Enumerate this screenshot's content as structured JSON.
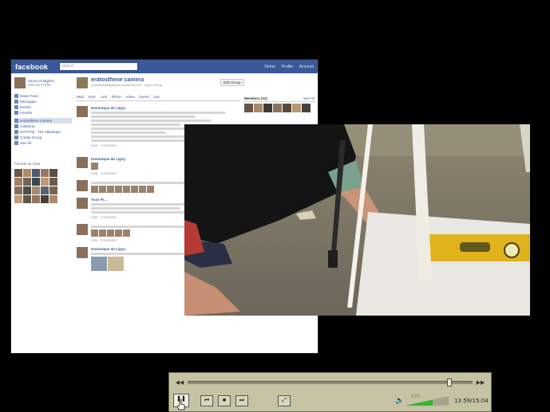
{
  "facebook": {
    "logo": "facebook",
    "search_placeholder": "search",
    "nav": [
      "Home",
      "Profile",
      "Account"
    ],
    "profile_name": "Simon Hodgkins",
    "profile_link": "Edit My Profile",
    "sidebar_items": [
      "News Feed",
      "Messages",
      "Events",
      "Friends",
      "eratosthène caméra",
      "Cafeteria",
      "INFOTIQ - The Atlantique",
      "Create Group",
      "See All"
    ],
    "sidebar_photos_title": "Friends on Chat",
    "page": {
      "title": "eratosthene camera",
      "subtitle": "eratosthene@groups.facebook.com · Open Group",
      "edit_button": "Edit Group",
      "tabs": [
        "Wall",
        "Post",
        "Link",
        "Photo",
        "Video",
        "Event",
        "Doc"
      ]
    },
    "posts": [
      {
        "name": "Dominique de Ligny",
        "meta": "Like · Comment"
      },
      {
        "name": "Dominique de Ligny",
        "meta": "Like · Comment"
      },
      {
        "name": "Yvan Pr...",
        "meta": "Like · Comment"
      },
      {
        "name": "Dominique de Ligny",
        "meta": "Like · Comment"
      },
      {
        "name": "Dominique de Ligny",
        "meta": "Like · Comment"
      }
    ],
    "right": {
      "members_title": "Members (11)",
      "members_link": "See All"
    }
  },
  "player": {
    "seek": {
      "position_fraction": 0.92
    },
    "time": "13:59/15:04",
    "volume": {
      "percent_text": "63%",
      "level": 0.63
    },
    "buttons": [
      "pause",
      "previous",
      "stop",
      "next",
      "fullscreen"
    ]
  }
}
